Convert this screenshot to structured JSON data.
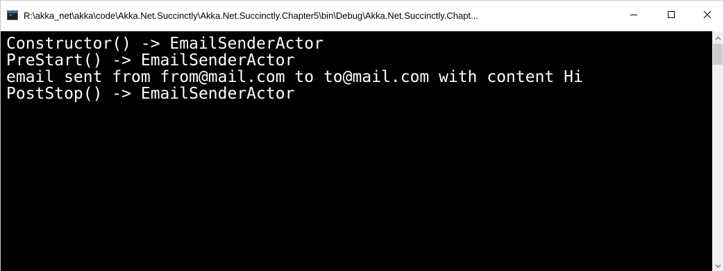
{
  "window": {
    "title": "R:\\akka_net\\akka\\code\\Akka.Net.Succinctly\\Akka.Net.Succinctly.Chapter5\\bin\\Debug\\Akka.Net.Succinctly.Chapt...",
    "icon": "console-app-icon",
    "controls": {
      "minimize_icon": "minimize-icon",
      "maximize_icon": "maximize-icon",
      "close_icon": "close-icon"
    }
  },
  "console": {
    "background": "#000000",
    "foreground": "#ffffff",
    "lines": [
      "Constructor() -> EmailSenderActor",
      "PreStart() -> EmailSenderActor",
      "email sent from from@mail.com to to@mail.com with content Hi",
      "PostStop() -> EmailSenderActor"
    ]
  },
  "scrollbar": {
    "up_icon": "scroll-up-arrow-icon",
    "down_icon": "scroll-down-arrow-icon"
  }
}
